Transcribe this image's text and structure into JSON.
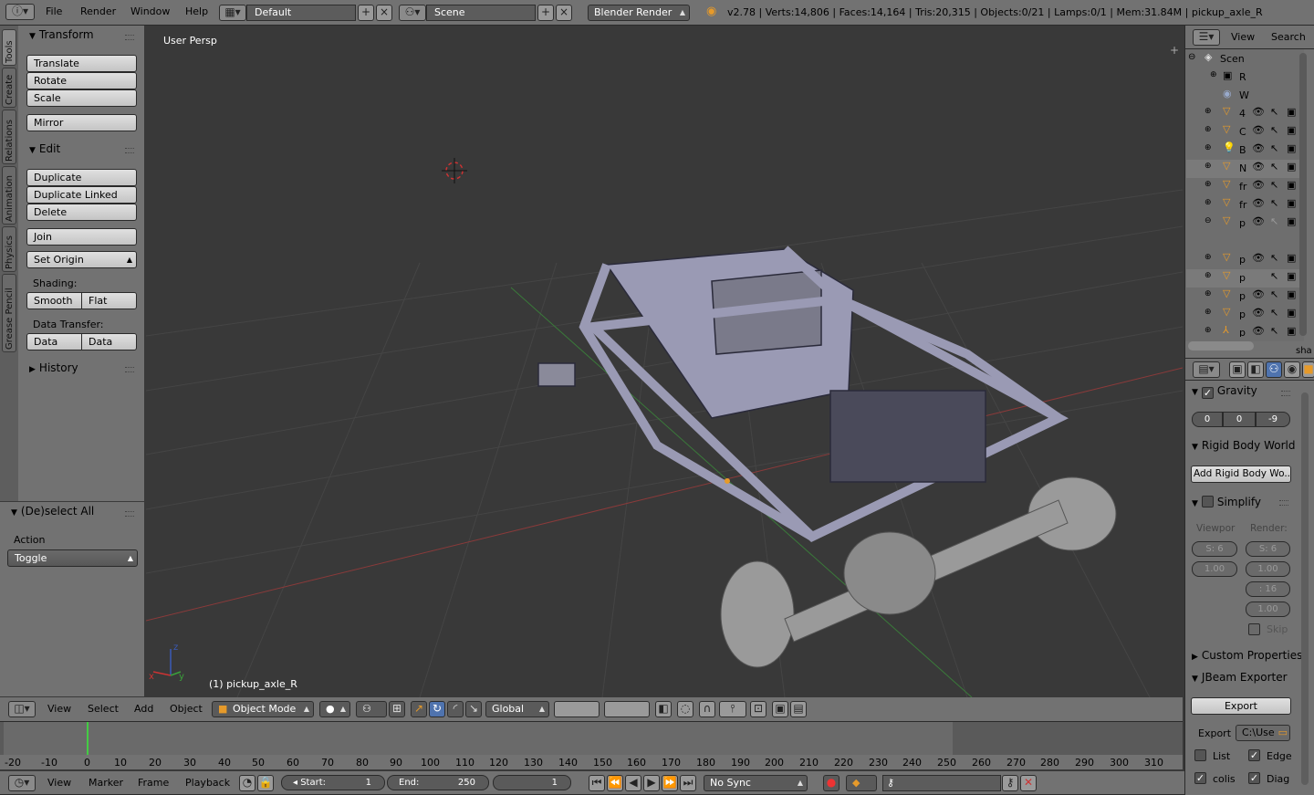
{
  "top_menu": {
    "file": "File",
    "render": "Render",
    "window": "Window",
    "help": "Help"
  },
  "layout_field": "Default",
  "scene_field": "Scene",
  "render_engine": "Blender Render",
  "stats": "v2.78 | Verts:14,806 | Faces:14,164 | Tris:20,315 | Objects:0/21 | Lamps:0/1 | Mem:31.84M | pickup_axle_R",
  "tool_tabs": [
    "Tools",
    "Create",
    "Relations",
    "Animation",
    "Physics",
    "Grease Pencil"
  ],
  "transform": {
    "title": "Transform",
    "translate": "Translate",
    "rotate": "Rotate",
    "scale": "Scale",
    "mirror": "Mirror"
  },
  "edit": {
    "title": "Edit",
    "duplicate": "Duplicate",
    "duplicate_linked": "Duplicate Linked",
    "delete": "Delete",
    "join": "Join",
    "set_origin": "Set Origin",
    "shading_label": "Shading:",
    "smooth": "Smooth",
    "flat": "Flat",
    "data_transfer_label": "Data Transfer:",
    "data": "Data",
    "data_layo": "Data Layo"
  },
  "history": {
    "title": "History"
  },
  "operator": {
    "title": "(De)select All",
    "action_label": "Action",
    "action_value": "Toggle"
  },
  "viewport": {
    "view_name": "User Persp",
    "object_label": "(1) pickup_axle_R"
  },
  "view_header": {
    "view": "View",
    "select": "Select",
    "add": "Add",
    "object": "Object",
    "mode": "Object Mode",
    "orientation": "Global"
  },
  "timeline": {
    "ticks": [
      "-20",
      "-10",
      "0",
      "10",
      "20",
      "30",
      "40",
      "50",
      "60",
      "70",
      "80",
      "90",
      "100",
      "110",
      "120",
      "130",
      "140",
      "150",
      "160",
      "170",
      "180",
      "190",
      "200",
      "210",
      "220",
      "230",
      "240",
      "250",
      "260",
      "270",
      "280",
      "290",
      "300",
      "310"
    ],
    "current_frame": "1",
    "start_label": "Start:",
    "start": "1",
    "end_label": "End:",
    "end": "250",
    "sync": "No Sync"
  },
  "timeline_header": {
    "view": "View",
    "marker": "Marker",
    "frame": "Frame",
    "playback": "Playback"
  },
  "outliner": {
    "view": "View",
    "search": "Search",
    "scene_label": "Scen",
    "items": [
      "R",
      "W",
      "4",
      "C",
      "B",
      "N",
      "fr",
      "fr",
      "p",
      "p",
      "p",
      "p",
      "p",
      "p"
    ],
    "bottom_text": "sha"
  },
  "properties": {
    "gravity": {
      "title": "Gravity",
      "x": "0",
      "y": "0",
      "z": "-9"
    },
    "rigid_body_world": {
      "title": "Rigid Body World",
      "add_button": "Add Rigid Body Wo..."
    },
    "simplify": {
      "title": "Simplify",
      "viewport_label": "Viewpor",
      "render_label": "Render:",
      "v_sub": "S: 6",
      "v_val": "1.00",
      "r_sub": "S: 6",
      "r_val": "1.00",
      "r_val2": ": 16",
      "r_val3": "1.00",
      "skip": "Skip"
    },
    "custom_properties": {
      "title": "Custom Properties"
    },
    "jbeam": {
      "title": "JBeam Exporter",
      "export_button": "Export",
      "export_label": "Export",
      "export_path": "C:\\Use",
      "list": "List",
      "edge": "Edge",
      "colis": "colis",
      "diag": "Diag"
    }
  },
  "colors": {
    "panel_bg": "#727272",
    "viewport_bg": "#393939",
    "selected_btn": "#4f73ae",
    "accent_orange": "#e69a2a"
  }
}
